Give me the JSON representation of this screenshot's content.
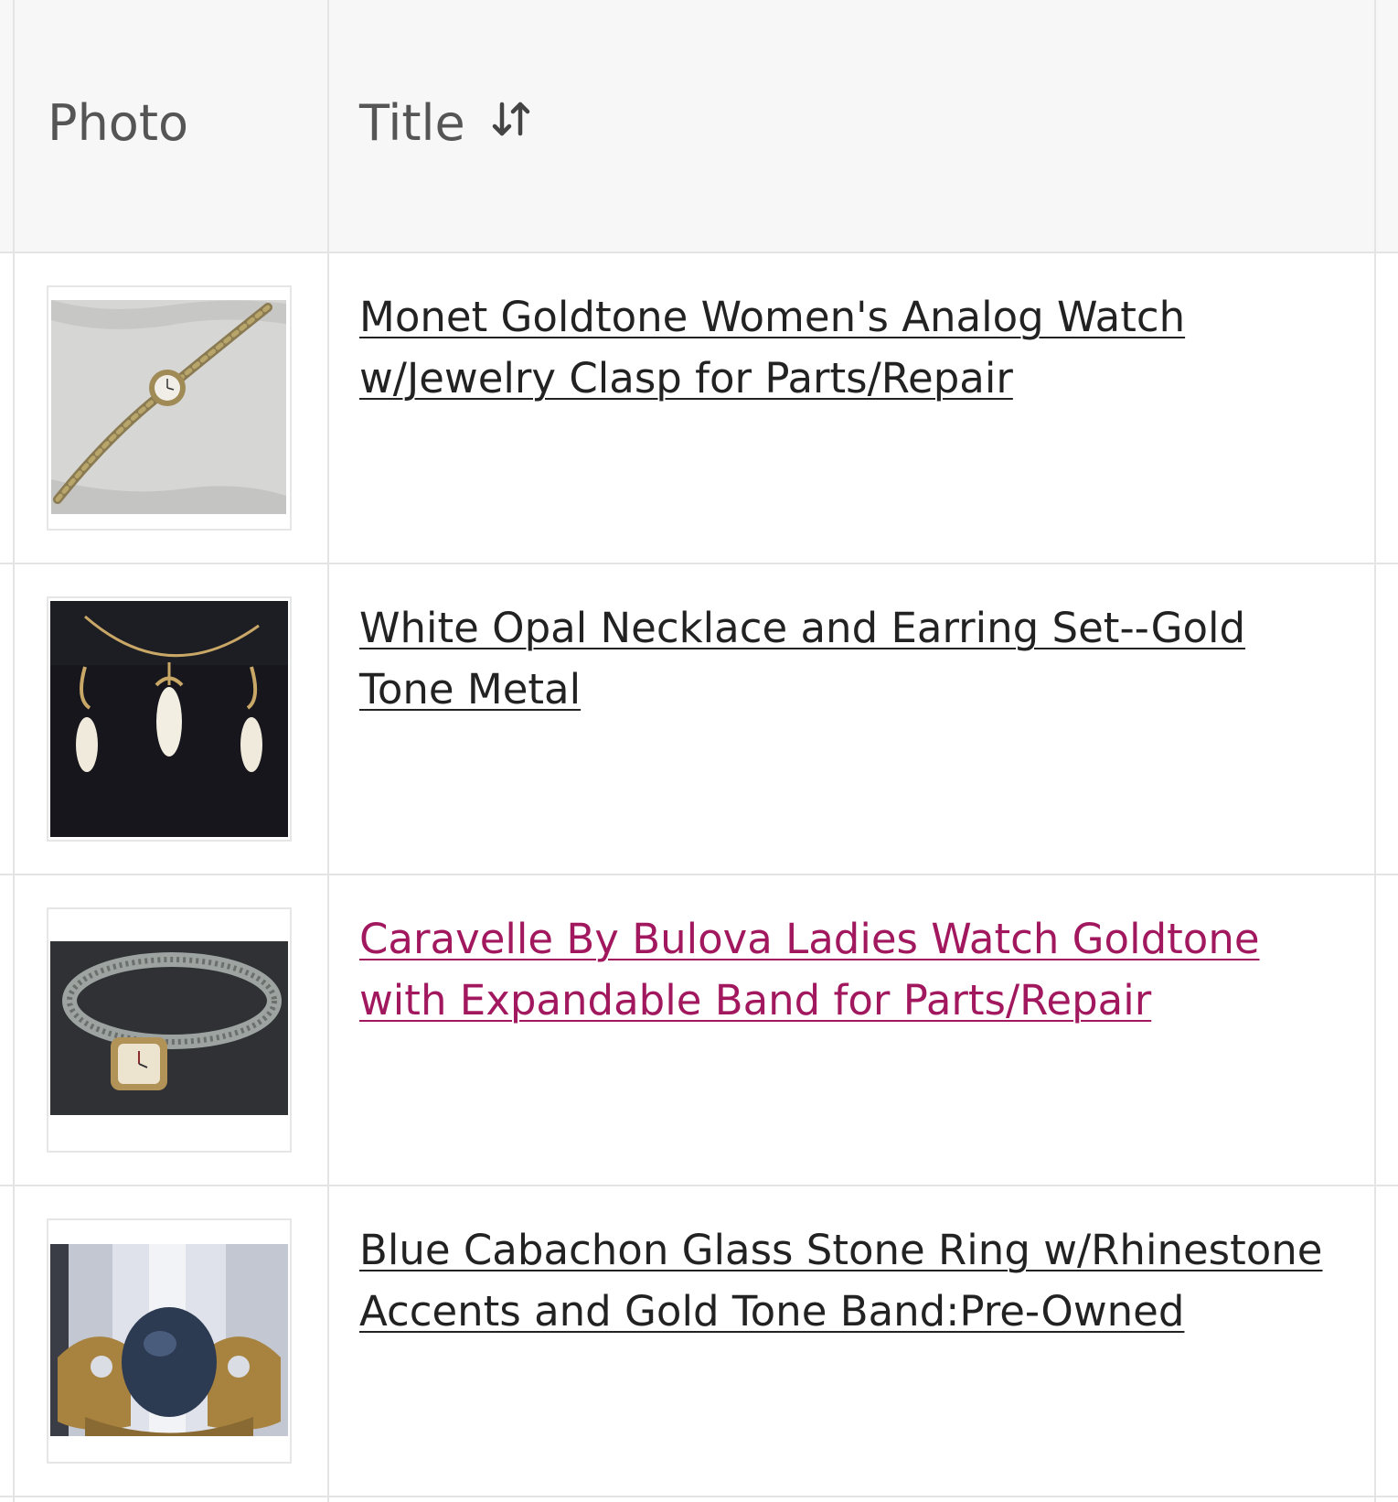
{
  "table": {
    "headers": {
      "photo": "Photo",
      "title": "Title"
    },
    "rows": [
      {
        "title": "Monet Goldtone Women's Analog Watch w/Jewelry Clasp for Parts/Repair",
        "photo_icon": "watch-bracelet-photo"
      },
      {
        "title": "White Opal Necklace and Earring Set--Gold Tone Metal",
        "photo_icon": "opal-necklace-earrings-photo"
      },
      {
        "title": "Caravelle By Bulova Ladies Watch Goldtone with Expandable Band for Parts/Repair",
        "photo_icon": "expandable-band-watch-photo",
        "link_color": "#a2185f"
      },
      {
        "title": "Blue Cabachon Glass Stone Ring w/Rhinestone Accents and Gold Tone Band:Pre-Owned",
        "photo_icon": "blue-stone-ring-photo"
      }
    ]
  }
}
